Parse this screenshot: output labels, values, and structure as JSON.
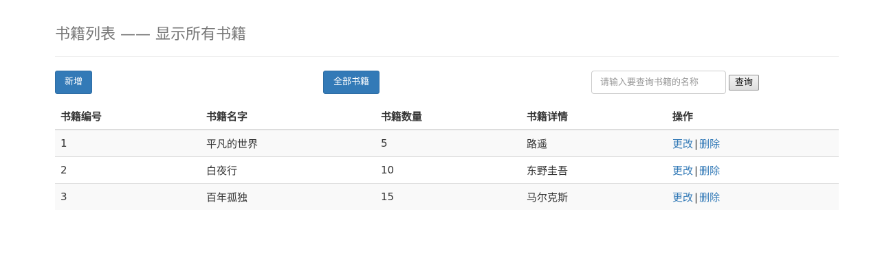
{
  "header": {
    "title": "书籍列表 —— 显示所有书籍"
  },
  "toolbar": {
    "add_label": "新增",
    "all_books_label": "全部书籍",
    "search_placeholder": "请输入要查询书籍的名称",
    "search_value": "",
    "query_label": "查询"
  },
  "table": {
    "columns": [
      "书籍编号",
      "书籍名字",
      "书籍数量",
      "书籍详情",
      "操作"
    ],
    "rows": [
      {
        "id": "1",
        "name": "平凡的世界",
        "count": "5",
        "detail": "路遥",
        "edit": "更改",
        "separator": "|",
        "delete": "删除"
      },
      {
        "id": "2",
        "name": "白夜行",
        "count": "10",
        "detail": "东野圭吾",
        "edit": "更改",
        "separator": "|",
        "delete": "删除"
      },
      {
        "id": "3",
        "name": "百年孤独",
        "count": "15",
        "detail": "马尔克斯",
        "edit": "更改",
        "separator": "|",
        "delete": "删除"
      }
    ]
  },
  "colors": {
    "primary": "#337ab7",
    "link": "#337ab7",
    "title": "#777777",
    "stripe": "#f9f9f9"
  }
}
